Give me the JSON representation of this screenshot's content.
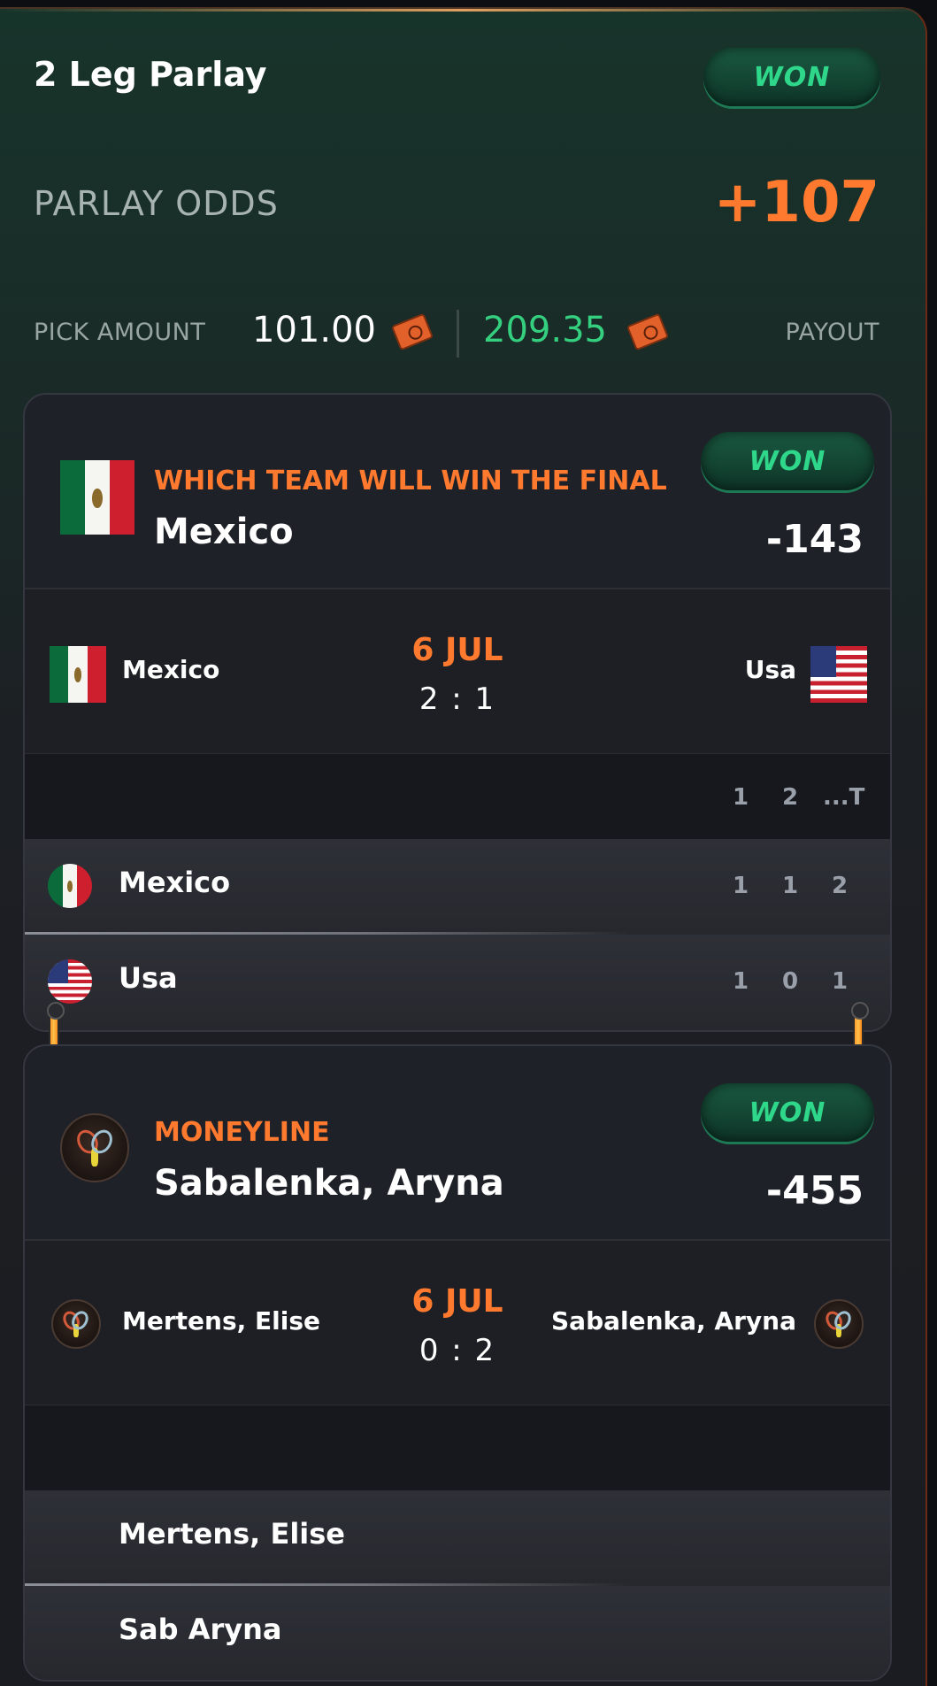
{
  "parlay": {
    "title": "2 Leg Parlay",
    "status": "WON",
    "odds_label": "PARLAY ODDS",
    "odds_value": "+107",
    "pick_amount_label": "PICK AMOUNT",
    "pick_amount": "101.00",
    "payout_value": "209.35",
    "payout_label": "PAYOUT"
  },
  "legs": [
    {
      "status": "WON",
      "market": "WHICH TEAM WILL WIN THE FINAL",
      "selection": "Mexico",
      "odds": "-143",
      "match": {
        "home": "Mexico",
        "away": "Usa",
        "date": "6 JUL",
        "score": "2 : 1"
      },
      "scoreboard": {
        "columns": [
          "1",
          "2",
          "...T"
        ],
        "rows": [
          {
            "name": "Mexico",
            "scores": [
              "1",
              "1",
              "2"
            ]
          },
          {
            "name": "Usa",
            "scores": [
              "1",
              "0",
              "1"
            ]
          }
        ]
      }
    },
    {
      "status": "WON",
      "market": "MONEYLINE",
      "selection": "Sabalenka, Aryna",
      "odds": "-455",
      "match": {
        "home": "Mertens, Elise",
        "away": "Sabalenka, Aryna",
        "date": "6 JUL",
        "score": "0 : 2"
      },
      "scoreboard": {
        "rows": [
          {
            "name": "Mertens, Elise"
          },
          {
            "name": "Sab Aryna"
          }
        ]
      }
    }
  ],
  "colors": {
    "accent": "#ff7a2e",
    "won": "#2fd78a",
    "payout": "#34d07f"
  },
  "icons": [
    "mexico-flag-icon",
    "usa-flag-icon",
    "tennis-icon",
    "coin-icon"
  ]
}
